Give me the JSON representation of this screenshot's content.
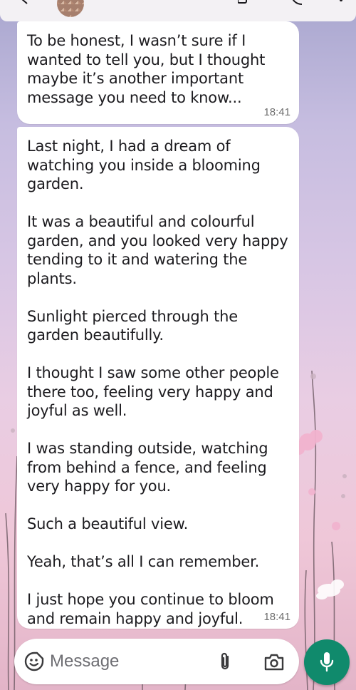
{
  "chat": {
    "messages": [
      {
        "paragraphs": [
          "To be honest, I wasn’t sure if I wanted to tell you, but I thought maybe it’s another important message you need to know..."
        ],
        "time": "18:41"
      },
      {
        "paragraphs": [
          "Last night, I had a dream of watching you inside a blooming garden.",
          "It was a beautiful and colourful garden, and you looked very happy tending to it and watering the plants.",
          "Sunlight pierced through the garden beautifully.",
          "I thought I saw some other people there too, feeling very happy and joyful as well.",
          "I was standing outside, watching from behind a fence, and feeling very happy for you.",
          "Such a beautiful view.",
          "Yeah, that’s all I can remember.",
          "I just hope you continue to bloom and remain happy and joyful."
        ],
        "time": "18:41"
      }
    ]
  },
  "composer": {
    "placeholder": "Message",
    "icons": [
      "emoji-icon",
      "attach-icon",
      "camera-icon",
      "mic-icon"
    ],
    "mic_color": "#108a6c"
  },
  "header": {
    "icons": [
      "back-arrow-icon",
      "video-call-icon",
      "call-icon",
      "menu-icon"
    ]
  }
}
